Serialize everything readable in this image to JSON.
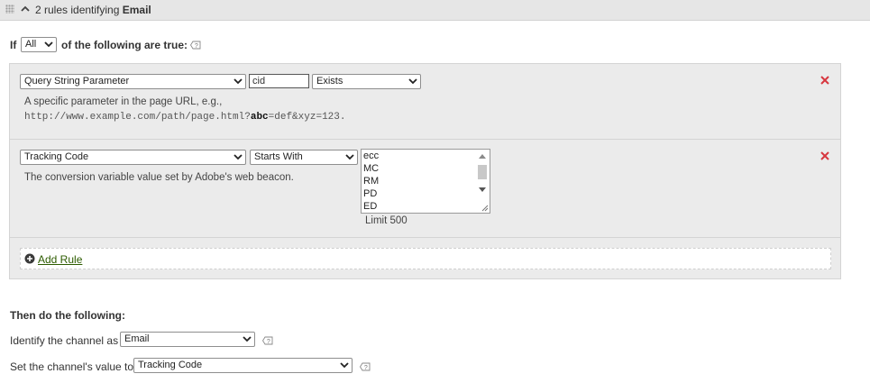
{
  "header": {
    "prefix": "2 rules identifying",
    "channel": "Email"
  },
  "condition": {
    "if_label": "If",
    "match_value": "All",
    "suffix": "of the following are true:"
  },
  "rules": [
    {
      "type": "Query String Parameter",
      "param": "cid",
      "operator": "Exists",
      "description": "A specific parameter in the page URL, e.g.,",
      "example_pre": "http://www.example.com/path/page.html?",
      "example_bold": "abc",
      "example_post": "=def&xyz=123."
    },
    {
      "type": "Tracking Code",
      "operator": "Starts With",
      "description": "The conversion variable value set by Adobe's web beacon.",
      "values": [
        "ecc",
        "MC",
        "RM",
        "PD",
        "ED"
      ],
      "limit": "Limit 500"
    }
  ],
  "add_rule_label": "Add Rule",
  "then": {
    "heading": "Then do the following:",
    "identify_label": "Identify the channel as",
    "identify_value": "Email",
    "value_label": "Set the channel's value to",
    "value_value": "Tracking Code"
  },
  "colors": {
    "remove": "#d7373f",
    "add_icon": "#3a3a3a",
    "add_link": "#2d5c00"
  },
  "icons": {
    "drag": "drag-handle-icon",
    "collapse": "chevron-up-icon",
    "help": "help-icon",
    "remove": "close-icon",
    "add": "plus-circle-icon"
  }
}
